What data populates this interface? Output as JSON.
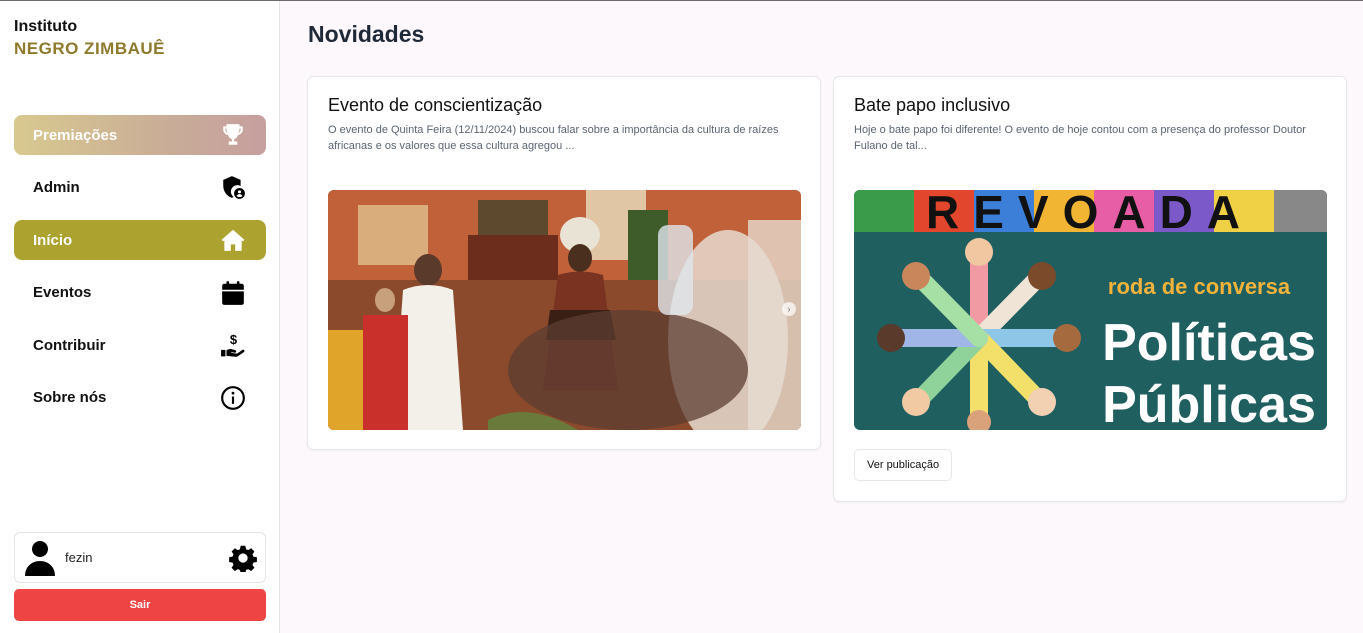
{
  "brand": {
    "line1": "Instituto",
    "line2": "NEGRO ZIMBAUÊ"
  },
  "sidebar": {
    "items": [
      {
        "label": "Premiações",
        "icon": "trophy-icon"
      },
      {
        "label": "Admin",
        "icon": "shield-user-icon"
      },
      {
        "label": "Início",
        "icon": "home-icon",
        "active": true
      },
      {
        "label": "Eventos",
        "icon": "calendar-icon"
      },
      {
        "label": "Contribuir",
        "icon": "hand-dollar-icon"
      },
      {
        "label": "Sobre nós",
        "icon": "info-icon"
      }
    ],
    "user": {
      "name": "fezin"
    },
    "logout_label": "Sair"
  },
  "main": {
    "title": "Novidades",
    "posts": [
      {
        "title": "Evento de conscientização",
        "description": "O evento de Quinta Feira (12/11/2024) buscou falar sobre a importância da cultura de raízes africanas e os valores que essa cultura agregou ..."
      },
      {
        "title": "Bate papo inclusivo",
        "description": "Hoje o bate papo foi diferente! O evento de hoje contou com a presença do professor Doutor Fulano de tal...",
        "button_label": "Ver publicação",
        "image_text": {
          "header": "REVOADA",
          "line1": "roda de conversa",
          "line2": "Políticas",
          "line3": "Públicas"
        }
      }
    ]
  },
  "colors": {
    "active": "#aba22f",
    "brand_gold": "#8e7a2c",
    "logout": "#ef4444"
  }
}
